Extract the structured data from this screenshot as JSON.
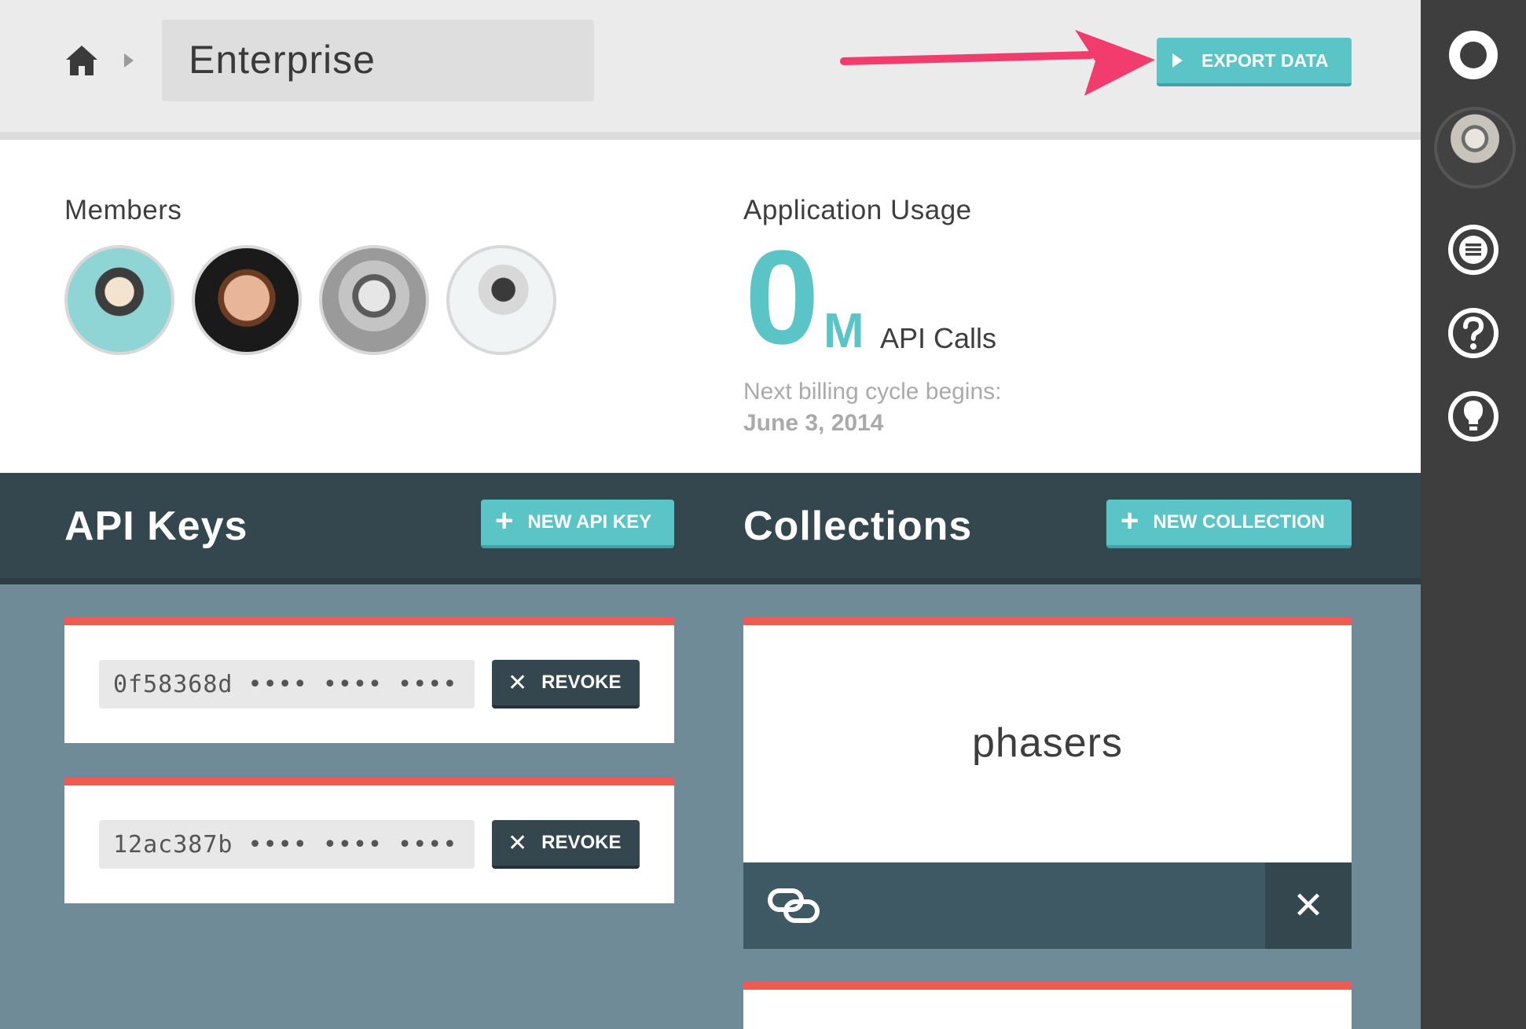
{
  "header": {
    "org_name": "Enterprise",
    "export_label": "EXPORT DATA"
  },
  "colors": {
    "accent": "#5bc4c6",
    "dark": "#34474f",
    "red_stripe": "#f05a50",
    "annotation_arrow": "#f23c6d"
  },
  "members": {
    "label": "Members",
    "avatars": [
      "member-avatar",
      "member-avatar",
      "member-avatar",
      "member-avatar"
    ]
  },
  "usage": {
    "label": "Application Usage",
    "value": "0",
    "unit": "M",
    "suffix": "API Calls",
    "billing_label": "Next billing cycle begins:",
    "billing_date": "June 3, 2014"
  },
  "api_keys": {
    "title": "API Keys",
    "new_label": "NEW API KEY",
    "items": [
      {
        "key": "0f58368d •••• •••• ••••",
        "revoke_label": "REVOKE"
      },
      {
        "key": "12ac387b •••• •••• ••••",
        "revoke_label": "REVOKE"
      }
    ]
  },
  "collections": {
    "title": "Collections",
    "new_label": "NEW COLLECTION",
    "items": [
      {
        "name": "phasers"
      }
    ]
  },
  "sidebar": {
    "icons": [
      "logo-icon",
      "user-avatar",
      "list-icon",
      "help-icon",
      "lightbulb-icon"
    ]
  }
}
